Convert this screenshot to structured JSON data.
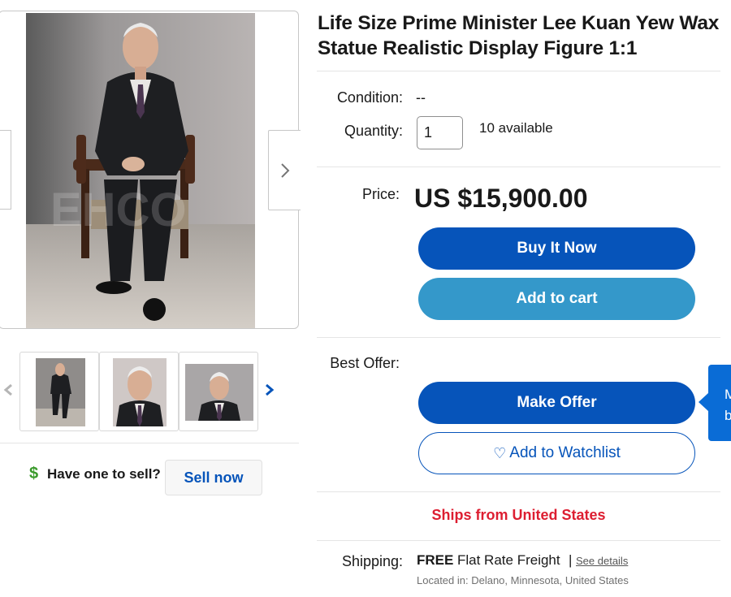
{
  "listing": {
    "title": "Life Size Prime Minister Lee Kuan Yew Wax Statue Realistic Display Figure 1:1",
    "condition_label": "Condition:",
    "condition_value": "--",
    "quantity_label": "Quantity:",
    "quantity_value": "1",
    "available_text": "10 available",
    "price_label": "Price:",
    "price": "US $15,900.00",
    "best_offer_label": "Best Offer:"
  },
  "buttons": {
    "buy_now": "Buy It Now",
    "add_to_cart": "Add to cart",
    "make_offer": "Make Offer",
    "add_to_watchlist": "Add to Watchlist"
  },
  "tooltip": {
    "line1": "M",
    "line2": "b"
  },
  "ships_from": "Ships from United States",
  "shipping": {
    "label": "Shipping:",
    "free": "FREE",
    "method": "Flat Rate Freight",
    "separator": "|",
    "details_link": "See details",
    "location": "Located in:  Delano, Minnesota, United States"
  },
  "sell": {
    "prompt": "Have one to sell?",
    "button": "Sell now"
  },
  "icons": {
    "dollar": "$",
    "heart": "♡"
  },
  "colors": {
    "primary_blue": "#0654ba",
    "cart_blue": "#3498ca",
    "ships_red": "#dd1e31",
    "dollar_green": "#3a9a2b"
  }
}
